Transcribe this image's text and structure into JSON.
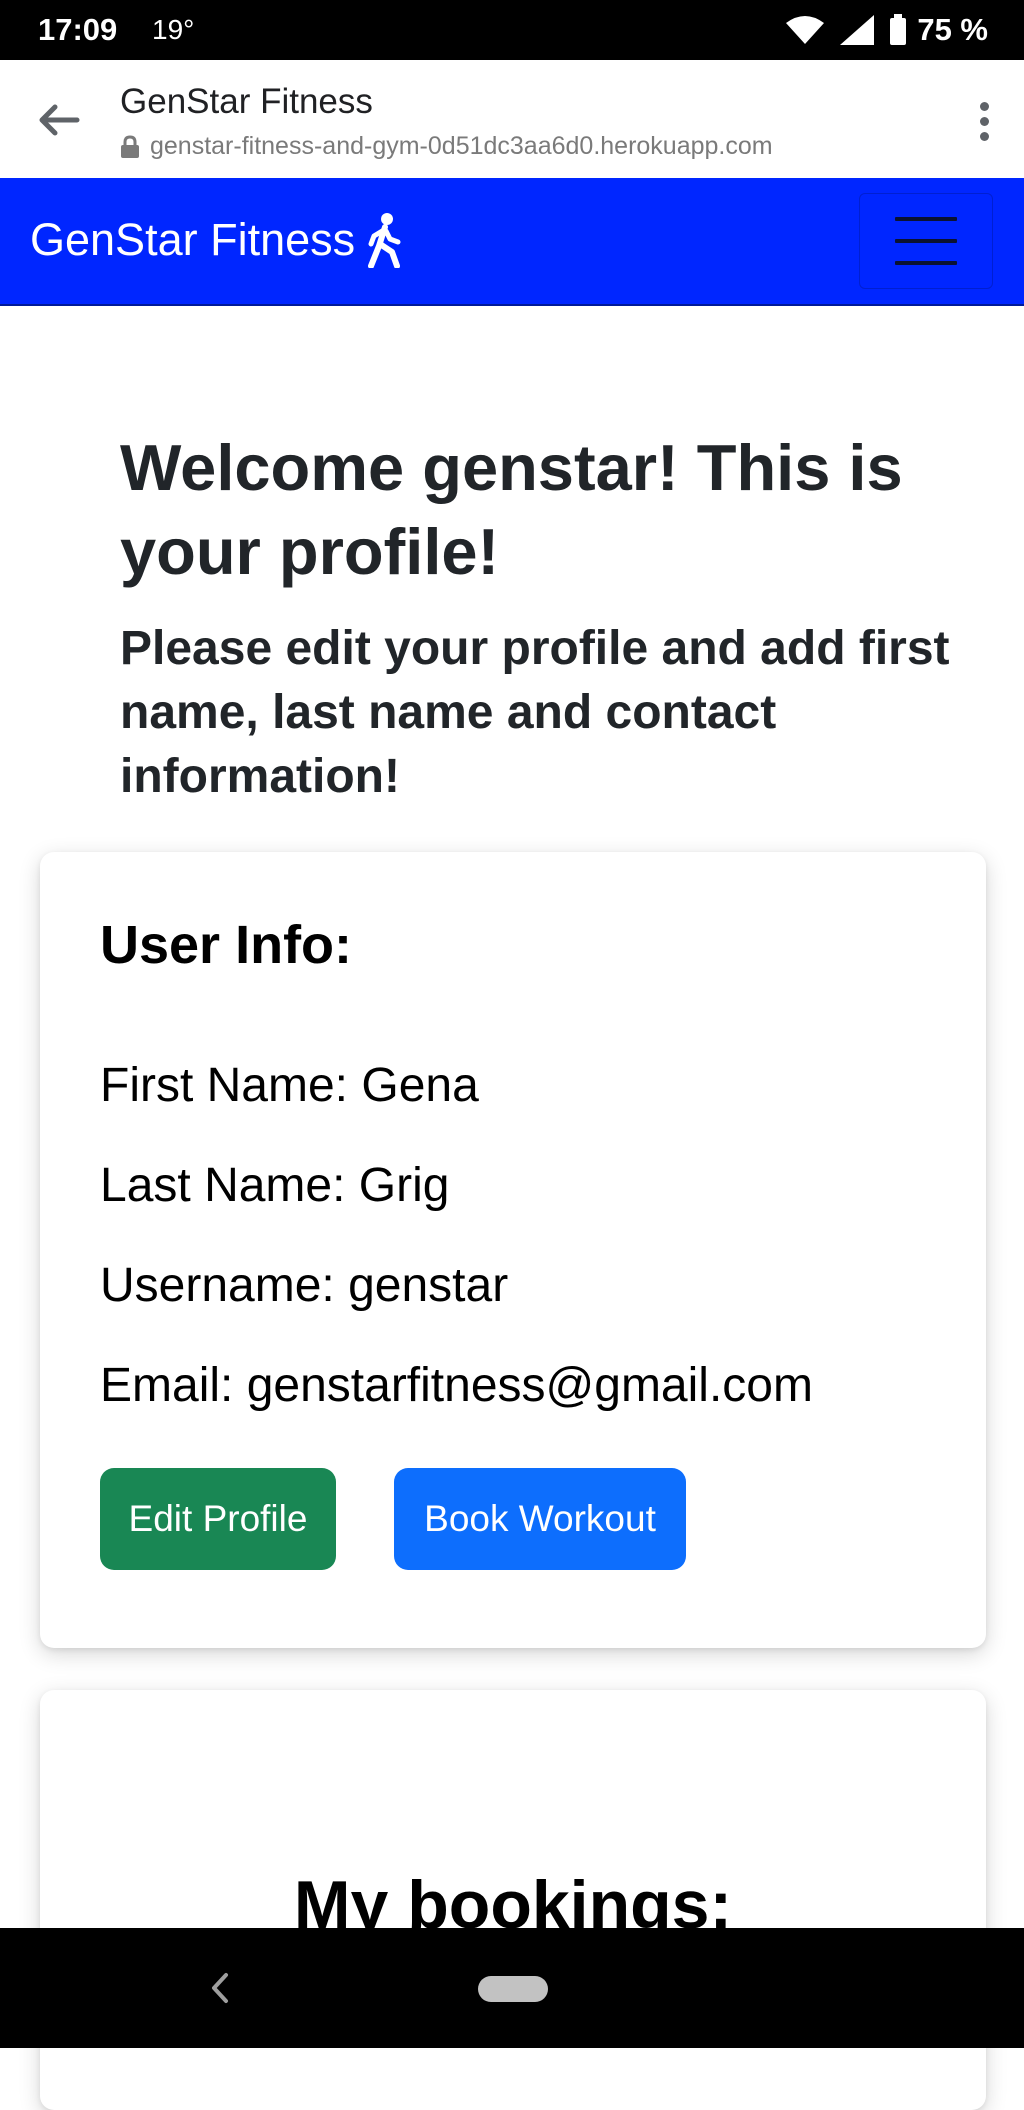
{
  "status_bar": {
    "time": "17:09",
    "temperature": "19°",
    "battery": "75 %"
  },
  "browser": {
    "title": "GenStar Fitness",
    "url": "genstar-fitness-and-gym-0d51dc3aa6d0.herokuapp.com"
  },
  "navbar": {
    "brand": "GenStar Fitness",
    "brand_icon": "person-walking-icon",
    "toggle_icon": "hamburger-menu-icon",
    "color": "#0026ff"
  },
  "page": {
    "welcome_title": "Welcome genstar! This is your profile!",
    "welcome_subtitle": "Please edit your profile and add first name, last name and contact information!"
  },
  "user_info": {
    "heading": "User Info:",
    "first_name": "First Name: Gena",
    "last_name": "Last Name: Grig",
    "username": "Username: genstar",
    "email": "Email: genstarfitness@gmail.com",
    "edit_button": "Edit Profile",
    "book_button": "Book Workout",
    "edit_button_color": "#198754",
    "book_button_color": "#0d6efd"
  },
  "bookings": {
    "heading": "My bookings:"
  }
}
